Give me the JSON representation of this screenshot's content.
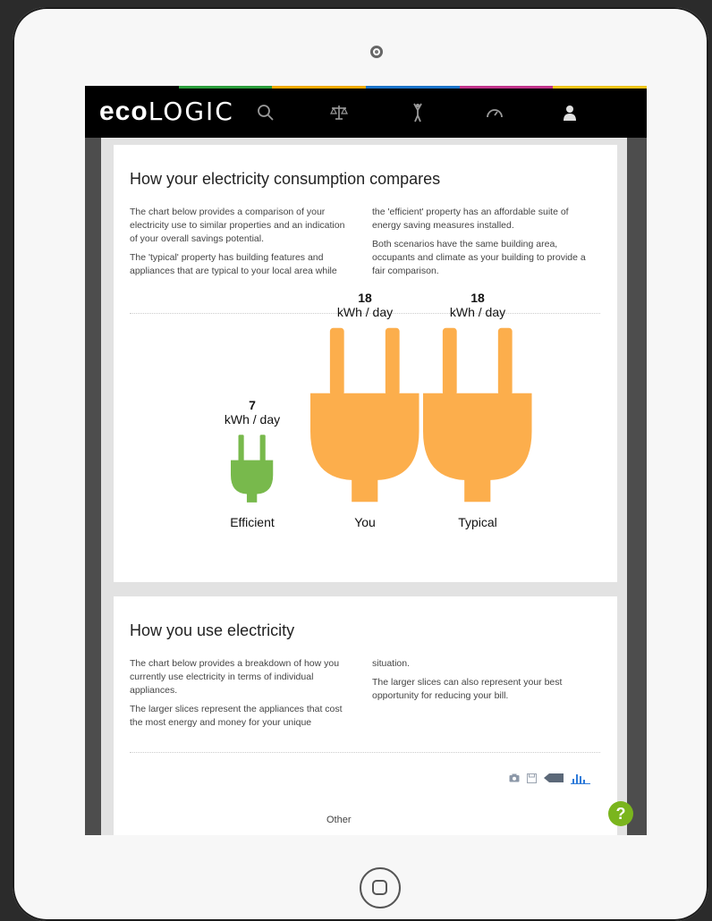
{
  "app": {
    "logo_bold": "eco",
    "logo_light": "LOGIC",
    "accent_colors": [
      "#000000",
      "#2a9d3b",
      "#f2a900",
      "#1a73c9",
      "#c0338a",
      "#f0c419"
    ]
  },
  "nav": {
    "items": [
      {
        "icon": "search-icon"
      },
      {
        "icon": "scales-icon"
      },
      {
        "icon": "person-icon"
      },
      {
        "icon": "gauge-icon"
      },
      {
        "icon": "user-icon"
      }
    ]
  },
  "compare_card": {
    "title": "How your electricity consumption compares",
    "left_paragraphs": [
      "The chart below provides a comparison of your electricity use to similar properties and an indication of your overall savings potential.",
      "The 'typical' property has building features and appliances that are typical to your local area while"
    ],
    "right_paragraphs": [
      "the 'efficient' property has an affordable suite of energy saving measures installed.",
      "Both scenarios have the same building area, occupants and climate as your building to provide a fair comparison."
    ]
  },
  "chart_data": {
    "type": "bar",
    "categories": [
      "Efficient",
      "You",
      "Typical"
    ],
    "values": [
      7,
      18,
      18
    ],
    "unit": "kWh / day",
    "colors": [
      "#78b94c",
      "#fcae4c",
      "#fcae4c"
    ]
  },
  "usage_card": {
    "title": "How you use electricity",
    "left_paragraphs": [
      "The chart below provides a breakdown of how you currently use electricity in terms of individual appliances.",
      "The larger slices represent the appliances that cost the most energy and money for your unique"
    ],
    "right_paragraphs": [
      "situation.",
      "The larger slices can also represent your best opportunity for reducing your bill."
    ],
    "toolbar": [
      {
        "icon": "camera-icon"
      },
      {
        "icon": "save-icon"
      },
      {
        "icon": "tag-icon"
      },
      {
        "icon": "bar-chart-icon"
      }
    ],
    "pie_label": "Other"
  },
  "help": {
    "label": "?"
  }
}
